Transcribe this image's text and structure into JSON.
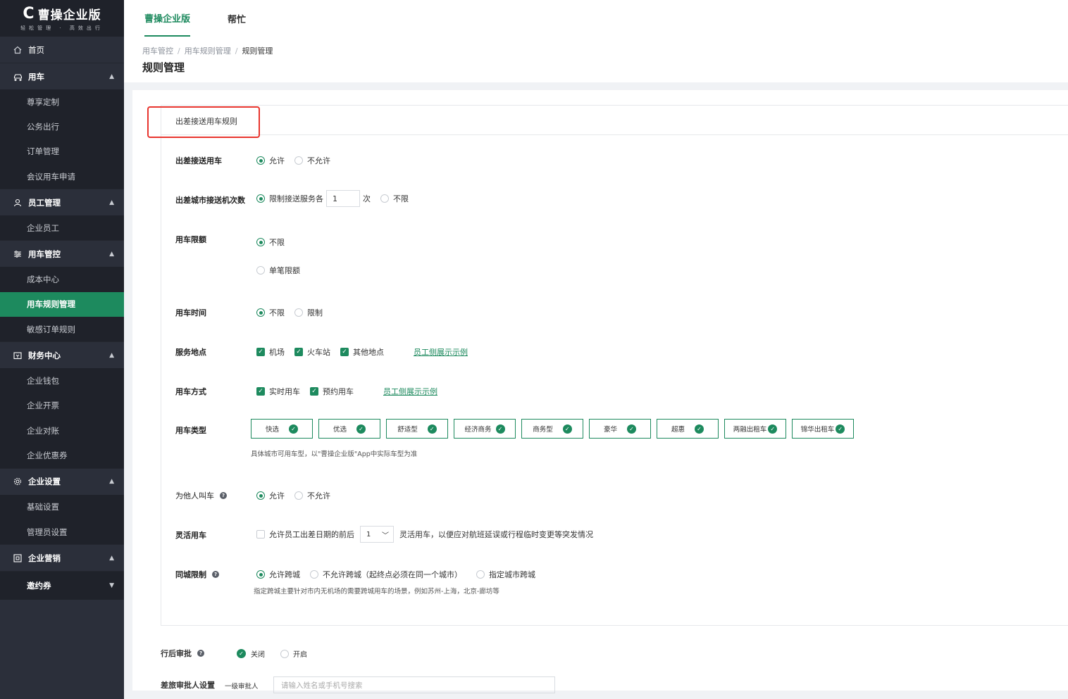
{
  "logo": {
    "mark": "C",
    "name": "曹操企业版",
    "slogan": "轻松管理 · 高效出行"
  },
  "sidebar": {
    "home": "首页",
    "groups": [
      {
        "label": "用车",
        "items": [
          "尊享定制",
          "公务出行",
          "订单管理",
          "会议用车申请"
        ]
      },
      {
        "label": "员工管理",
        "items": [
          "企业员工"
        ]
      },
      {
        "label": "用车管控",
        "items": [
          "成本中心",
          "用车规则管理",
          "敏感订单规则"
        ]
      },
      {
        "label": "财务中心",
        "items": [
          "企业钱包",
          "企业开票",
          "企业对账",
          "企业优惠券"
        ]
      },
      {
        "label": "企业设置",
        "items": [
          "基础设置",
          "管理员设置"
        ]
      },
      {
        "label": "企业营销",
        "items": []
      }
    ],
    "last": "邀约券",
    "active_item": "用车规则管理"
  },
  "topbar": {
    "tabs": [
      "曹操企业版",
      "帮忙"
    ]
  },
  "breadcrumb": [
    "用车管控",
    "用车规则管理",
    "规则管理"
  ],
  "page_title": "规则管理",
  "card": {
    "title": "出差接送用车规则",
    "rows": {
      "pickup": {
        "label": "出差接送用车",
        "opt1": "允许",
        "opt2": "不允许"
      },
      "times": {
        "label": "出差城市接送机次数",
        "opt1": "限制接送服务各",
        "value": "1",
        "unit": "次",
        "opt2": "不限"
      },
      "limit": {
        "label": "用车限额",
        "opt1": "不限",
        "opt2": "单笔限额"
      },
      "time": {
        "label": "用车时间",
        "opt1": "不限",
        "opt2": "限制"
      },
      "place": {
        "label": "服务地点",
        "opt1": "机场",
        "opt2": "火车站",
        "opt3": "其他地点",
        "link": "员工侧展示示例"
      },
      "mode": {
        "label": "用车方式",
        "opt1": "实时用车",
        "opt2": "预约用车",
        "link": "员工侧展示示例"
      },
      "types": {
        "label": "用车类型",
        "items": [
          "快选",
          "优选",
          "舒适型",
          "经济商务",
          "商务型",
          "豪华",
          "超惠",
          "两融出租车",
          "锦华出租车"
        ],
        "hint": "具体城市可用车型，以\"曹操企业版\"App中实际车型为准"
      },
      "others": {
        "label": "为他人叫车",
        "help": "?",
        "opt1": "允许",
        "opt2": "不允许"
      },
      "flex": {
        "label": "灵活用车",
        "text1": "允许员工出差日期的前后",
        "select": "1",
        "text2": "灵活用车，以便应对航班延误或行程临时变更等突发情况"
      },
      "city": {
        "label": "同城限制",
        "help": "?",
        "opt1": "允许跨城",
        "opt2": "不允许跨城（起终点必须在同一个城市）",
        "opt3": "指定城市跨城",
        "hint": "指定跨城主要针对市内无机场的需要跨城用车的场景，例如苏州-上海，北京-廊坊等"
      }
    }
  },
  "after": {
    "label": "行后审批",
    "help": "?",
    "opt1": "关闭",
    "opt2": "开启"
  },
  "approver": {
    "label": "差旅审批人设置",
    "sub": "一级审批人",
    "placeholder": "请输入姓名或手机号搜索"
  },
  "colors": {
    "brand": "#1d8a5e",
    "sidebar": "#2b2f3a",
    "highlight": "#e8352e"
  }
}
